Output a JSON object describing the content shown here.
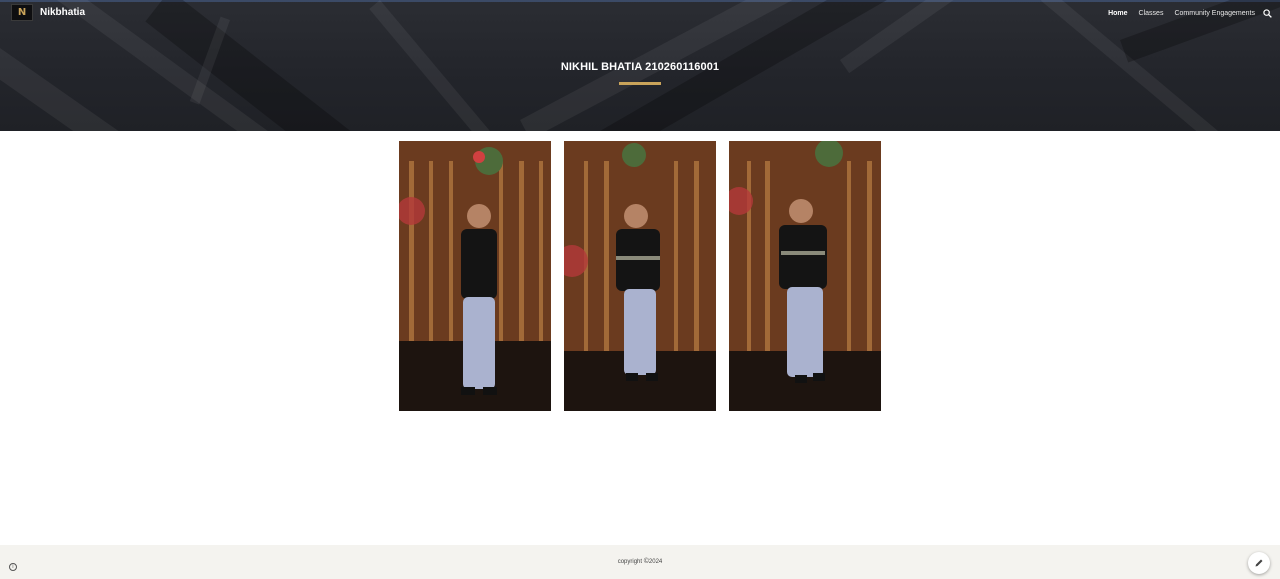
{
  "header": {
    "site_name": "Nikbhatia",
    "logo_letter": "N",
    "nav": [
      "Home",
      "Classes",
      "Community Engagements"
    ],
    "active_nav": "Home",
    "search_icon": "search-icon"
  },
  "hero": {
    "title": "NIKHIL BHATIA 210260116001",
    "accent_color": "#c9a35a"
  },
  "gallery": {
    "photos": [
      {
        "name": "photo-1"
      },
      {
        "name": "photo-2"
      },
      {
        "name": "photo-3"
      }
    ]
  },
  "footer": {
    "copyright_prefix": "copyright",
    "copyright_symbol": "©",
    "year": "2024",
    "info_icon": "info-icon",
    "edit_icon": "pencil-icon"
  }
}
